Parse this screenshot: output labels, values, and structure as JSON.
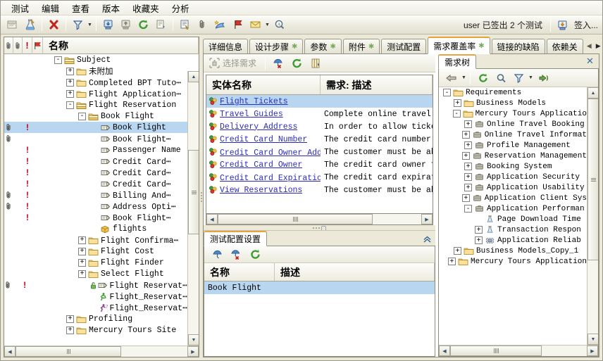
{
  "menu": {
    "items": [
      {
        "label": "测试"
      },
      {
        "label": "编辑"
      },
      {
        "label": "查看"
      },
      {
        "label": "版本"
      },
      {
        "label": "收藏夹"
      },
      {
        "label": "分析"
      }
    ]
  },
  "toolbar": {
    "status_text": "user 已签出 2 个测试",
    "signin_label": "签入...",
    "icons": [
      "new-folder-icon",
      "new-test-icon",
      "delete-icon",
      "filter-icon",
      "check-in-icon",
      "check-out-icon",
      "refresh-icon",
      "copy-icon",
      "details-icon",
      "attachment-icon",
      "add-to-favorites-icon",
      "flag-icon",
      "mail-icon",
      "find-icon"
    ]
  },
  "left_tree": {
    "header": {
      "attachment_col": "attachment-icon",
      "attachment_col2": "attachment-icon",
      "alert_col": "!",
      "flag_col": "flag-icon",
      "name_label": "名称"
    },
    "rows": [
      {
        "indent": 1,
        "exp": "-",
        "icon": "folder-open",
        "label": "Subject",
        "clip": false,
        "bang": false,
        "sel": false
      },
      {
        "indent": 2,
        "exp": "+",
        "icon": "folder",
        "label": "未附加",
        "clip": false,
        "bang": false,
        "sel": false
      },
      {
        "indent": 2,
        "exp": "+",
        "icon": "folder",
        "label": "Completed BPT Tuto⋯",
        "clip": false,
        "bang": false,
        "sel": false
      },
      {
        "indent": 2,
        "exp": "+",
        "icon": "folder",
        "label": "Flight Application⋯",
        "clip": false,
        "bang": false,
        "sel": false
      },
      {
        "indent": 2,
        "exp": "-",
        "icon": "folder-open",
        "label": "Flight Reservation",
        "clip": false,
        "bang": false,
        "sel": false
      },
      {
        "indent": 3,
        "exp": "-",
        "icon": "folder-open",
        "label": "Book Flight",
        "clip": false,
        "bang": false,
        "sel": false
      },
      {
        "indent": 4,
        "exp": "",
        "icon": "test",
        "label": "Book Flight",
        "clip": true,
        "bang": true,
        "sel": true
      },
      {
        "indent": 4,
        "exp": "",
        "icon": "test",
        "label": "Book Flight⋯",
        "clip": true,
        "bang": false,
        "sel": false
      },
      {
        "indent": 4,
        "exp": "",
        "icon": "test",
        "label": "Passenger Name",
        "clip": false,
        "bang": true,
        "sel": false
      },
      {
        "indent": 4,
        "exp": "",
        "icon": "test",
        "label": "Credit Card⋯",
        "clip": false,
        "bang": true,
        "sel": false
      },
      {
        "indent": 4,
        "exp": "",
        "icon": "test",
        "label": "Credit Card⋯",
        "clip": false,
        "bang": true,
        "sel": false
      },
      {
        "indent": 4,
        "exp": "",
        "icon": "test",
        "label": "Credit Card⋯",
        "clip": false,
        "bang": true,
        "sel": false
      },
      {
        "indent": 4,
        "exp": "",
        "icon": "test",
        "label": "Billing And⋯",
        "clip": true,
        "bang": true,
        "sel": false
      },
      {
        "indent": 4,
        "exp": "",
        "icon": "test",
        "label": "Address Opti⋯",
        "clip": true,
        "bang": true,
        "sel": false
      },
      {
        "indent": 4,
        "exp": "",
        "icon": "test",
        "label": "Book Flight⋯",
        "clip": false,
        "bang": true,
        "sel": false
      },
      {
        "indent": 4,
        "exp": "",
        "icon": "package",
        "label": "flights",
        "clip": false,
        "bang": false,
        "sel": false
      },
      {
        "indent": 3,
        "exp": "+",
        "icon": "folder",
        "label": "Flight Confirma⋯",
        "clip": false,
        "bang": false,
        "sel": false
      },
      {
        "indent": 3,
        "exp": "+",
        "icon": "folder",
        "label": "Flight Cost",
        "clip": false,
        "bang": false,
        "sel": false
      },
      {
        "indent": 3,
        "exp": "+",
        "icon": "folder",
        "label": "Flight Finder",
        "clip": false,
        "bang": false,
        "sel": false
      },
      {
        "indent": 3,
        "exp": "+",
        "icon": "folder",
        "label": "Select Flight",
        "clip": false,
        "bang": false,
        "sel": false
      },
      {
        "indent": 4,
        "exp": "",
        "icon": "test-locked",
        "label": "Flight Reservat⋯",
        "clip": true,
        "bang": true,
        "sel": false
      },
      {
        "indent": 4,
        "exp": "",
        "icon": "runner",
        "label": "Flight_Reservat⋯",
        "clip": false,
        "bang": false,
        "sel": false
      },
      {
        "indent": 4,
        "exp": "",
        "icon": "unknown",
        "label": "Flight_Reservat⋯",
        "clip": false,
        "bang": false,
        "sel": false
      },
      {
        "indent": 2,
        "exp": "+",
        "icon": "folder",
        "label": "Profiling",
        "clip": false,
        "bang": false,
        "sel": false
      },
      {
        "indent": 2,
        "exp": "+",
        "icon": "folder",
        "label": "Mercury Tours Site",
        "clip": false,
        "bang": false,
        "sel": false
      }
    ]
  },
  "main_tabs": [
    {
      "label": "详细信息",
      "asterisk": false,
      "active": false
    },
    {
      "label": "设计步骤",
      "asterisk": true,
      "active": false
    },
    {
      "label": "参数",
      "asterisk": true,
      "active": false
    },
    {
      "label": "附件",
      "asterisk": true,
      "active": false
    },
    {
      "label": "测试配置",
      "asterisk": false,
      "active": false
    },
    {
      "label": "需求覆盖率",
      "asterisk": true,
      "active": true
    },
    {
      "label": "链接的缺陷",
      "asterisk": false,
      "active": false
    },
    {
      "label": "依赖关",
      "asterisk": false,
      "active": false
    }
  ],
  "coverage": {
    "toolbar": {
      "select_req_label": "选择需求",
      "select_req_icon": "select-requirement-icon",
      "remove_icon": "remove-coverage-icon",
      "refresh_icon": "refresh-icon",
      "columns_icon": "select-columns-icon"
    },
    "grid": {
      "columns": [
        {
          "label": "实体名称"
        },
        {
          "label": "需求: 描述"
        }
      ],
      "rows": [
        {
          "name": "Flight Tickets",
          "desc": "",
          "sel": true
        },
        {
          "name": "Travel Guides",
          "desc": "Complete online travel gu",
          "sel": false
        },
        {
          "name": "Delivery Address",
          "desc": "In order to allow ticket",
          "sel": false
        },
        {
          "name": "Credit Card Number",
          "desc": "The credit card number mu",
          "sel": false
        },
        {
          "name": "Credit Card Owner Add⋯",
          "desc": "The customer must be able",
          "sel": false
        },
        {
          "name": "Credit Card Owner",
          "desc": "The credit card owner fir",
          "sel": false
        },
        {
          "name": "Credit Card Expiratio⋯",
          "desc": "The credit card expiration",
          "sel": false
        },
        {
          "name": "View Reservations",
          "desc": "The customer must be able",
          "sel": false
        }
      ]
    }
  },
  "bottom_panel": {
    "tab_label": "测试配置设置",
    "collapse_icon": "collapse-up-icon",
    "toolbar_icons": [
      "add-config-icon",
      "remove-config-icon",
      "refresh-icon"
    ],
    "columns": [
      {
        "label": "名称"
      },
      {
        "label": "描述"
      }
    ],
    "rows": [
      {
        "name": "Book Flight",
        "desc": "",
        "sel": true
      }
    ]
  },
  "req_tree_panel": {
    "tab_label": "需求树",
    "close_icon": "close-icon",
    "toolbar_icons": [
      "back-icon",
      "dropdown-arrow-icon",
      "refresh-icon",
      "find-icon",
      "filter-icon",
      "filter-dropdown-icon",
      "go-to-icon"
    ],
    "rows": [
      {
        "indent": 0,
        "exp": "-",
        "icon": "folder",
        "label": "Requirements"
      },
      {
        "indent": 1,
        "exp": "+",
        "icon": "folder",
        "label": "Business Models"
      },
      {
        "indent": 1,
        "exp": "-",
        "icon": "folder",
        "label": "Mercury Tours Applicatio"
      },
      {
        "indent": 2,
        "exp": "+",
        "icon": "req-folder",
        "label": "Online Travel Booking"
      },
      {
        "indent": 2,
        "exp": "+",
        "icon": "req-folder",
        "label": "Online Travel Informat"
      },
      {
        "indent": 2,
        "exp": "+",
        "icon": "req-folder",
        "label": "Profile Management"
      },
      {
        "indent": 2,
        "exp": "+",
        "icon": "req-folder",
        "label": "Reservation Management"
      },
      {
        "indent": 2,
        "exp": "+",
        "icon": "req-folder",
        "label": "Booking System"
      },
      {
        "indent": 2,
        "exp": "+",
        "icon": "req-folder",
        "label": "Application Security"
      },
      {
        "indent": 2,
        "exp": "+",
        "icon": "req-folder",
        "label": "Application Usability"
      },
      {
        "indent": 2,
        "exp": "+",
        "icon": "req-folder",
        "label": "Application Client Sys"
      },
      {
        "indent": 2,
        "exp": "-",
        "icon": "req-folder",
        "label": "Application Performan"
      },
      {
        "indent": 3,
        "exp": "",
        "icon": "req-test",
        "label": "Page Download Time"
      },
      {
        "indent": 3,
        "exp": "+",
        "icon": "req-test",
        "label": "Transaction Respon"
      },
      {
        "indent": 3,
        "exp": "+",
        "icon": "req-group",
        "label": "Application Reliab"
      },
      {
        "indent": 1,
        "exp": "+",
        "icon": "folder",
        "label": "Business Models_Copy_1"
      },
      {
        "indent": 1,
        "exp": "+",
        "icon": "folder",
        "label": "Mercury Tours Application"
      }
    ]
  },
  "colors": {
    "accent_orange": "#e8a33d",
    "selection_blue": "#b8d6f0",
    "link_blue": "#2b2bc0",
    "alert_red": "#c00020",
    "window_bg": "#ece9d8"
  }
}
